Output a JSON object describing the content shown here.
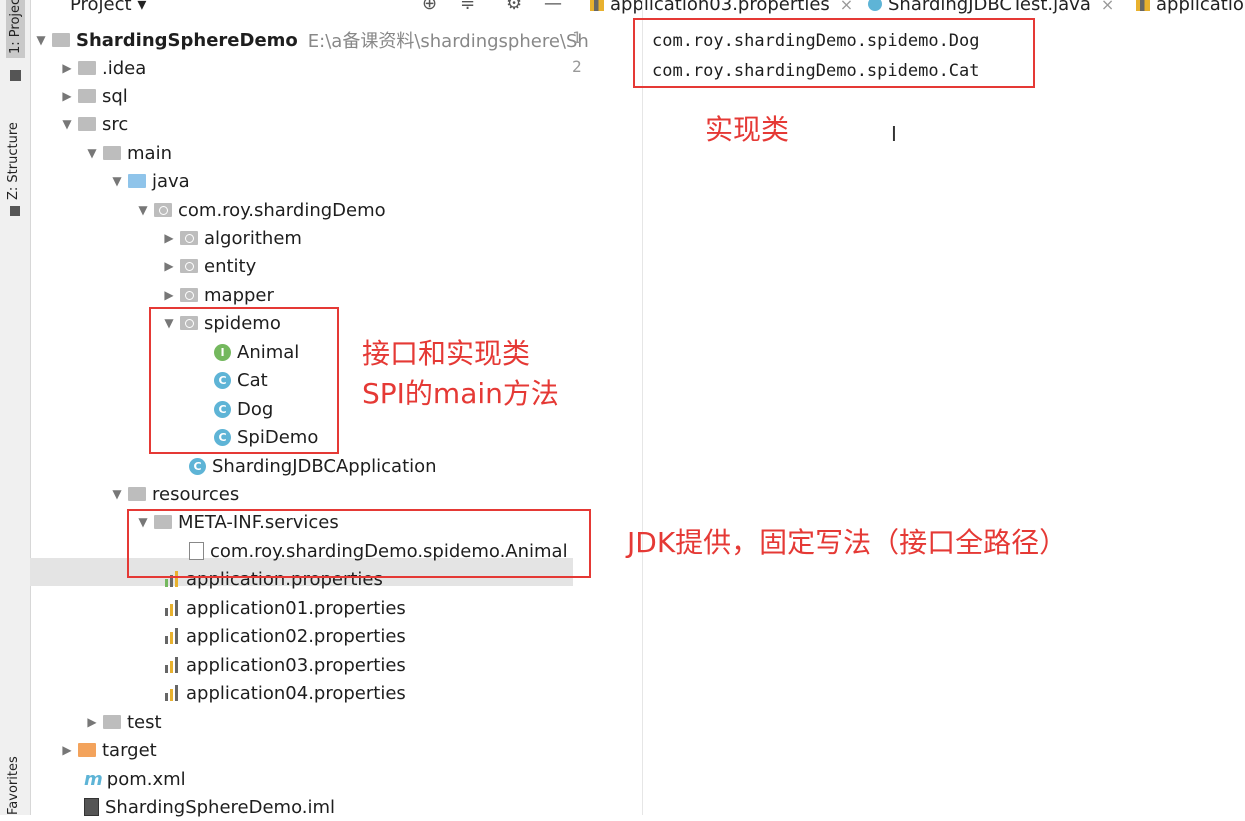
{
  "window": {
    "project_label": "Project",
    "left_tabs": [
      "1: Project",
      "Z: Structure",
      "Favorites"
    ],
    "editor_tabs": [
      {
        "label": "application03.properties"
      },
      {
        "label": "ShardingJDBCTest.java"
      },
      {
        "label": "applicatio"
      }
    ]
  },
  "tree": {
    "root": {
      "name": "ShardingSphereDemo",
      "path": "E:\\a备课资料\\shardingsphere\\Sh"
    },
    "idea": ".idea",
    "sql": "sql",
    "src": "src",
    "main": "main",
    "java": "java",
    "pkg": "com.roy.shardingDemo",
    "algorithem": "algorithem",
    "entity": "entity",
    "mapper": "mapper",
    "spidemo": "spidemo",
    "animal": "Animal",
    "cat": "Cat",
    "dog": "Dog",
    "spidemo_main": "SpiDemo",
    "app": "ShardingJDBCApplication",
    "resources": "resources",
    "metainf": "META-INF.services",
    "services_file": "com.roy.shardingDemo.spidemo.Animal",
    "props": [
      "application.properties",
      "application01.properties",
      "application02.properties",
      "application03.properties",
      "application04.properties"
    ],
    "test": "test",
    "target": "target",
    "pom": "pom.xml",
    "iml": "ShardingSphereDemo.iml"
  },
  "editor": {
    "line_numbers": [
      "1",
      "2"
    ],
    "lines": [
      "com.roy.shardingDemo.spidemo.Dog",
      "com.roy.shardingDemo.spidemo.Cat"
    ]
  },
  "annotations": {
    "impl": "实现类",
    "iface_line1": "接口和实现类",
    "iface_line2": "SPI的main方法",
    "jdk": "JDK提供，固定写法（接口全路径）"
  },
  "colors": {
    "annotation_red": "#e53935",
    "selection": "#e4e4e4"
  }
}
